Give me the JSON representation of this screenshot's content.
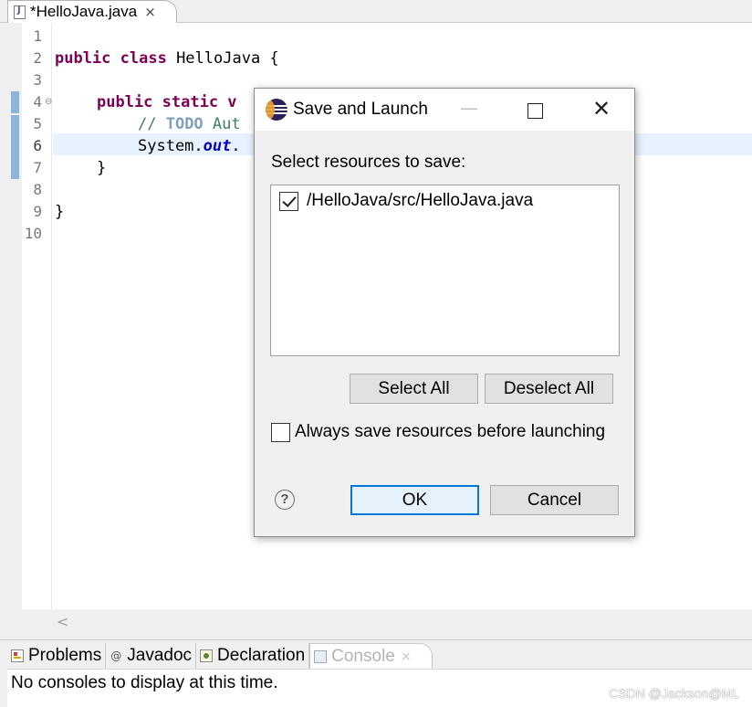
{
  "editor": {
    "tab_title": "*HelloJava.java",
    "tab_close": "×",
    "line_numbers": [
      "1",
      "2",
      "3",
      "4",
      "5",
      "6",
      "7",
      "8",
      "9",
      "10"
    ],
    "code": {
      "l2_kw": "public class",
      "l2_rest": " HelloJava {",
      "l4_kw": "public static",
      "l4_rest": " v",
      "l5_comment": "// ",
      "l5_todo": "TODO",
      "l5_rest": " Aut",
      "l6_pre": "System.",
      "l6_field": "out",
      "l6_post": ".",
      "l7": "}",
      "l9": "}"
    },
    "scroll_left_glyph": "<"
  },
  "bottom_views": {
    "tabs": [
      {
        "label": "Problems"
      },
      {
        "label": "Javadoc",
        "icon_glyph": "@"
      },
      {
        "label": "Declaration"
      },
      {
        "label": "Console",
        "close": "×"
      }
    ],
    "console_message": "No consoles to display at this time.",
    "watermark": "CSDN @Jackson@ML"
  },
  "dialog": {
    "title": "Save and Launch",
    "minimize_glyph": "—",
    "close_glyph": "✕",
    "select_label": "Select resources to save:",
    "resources": [
      {
        "path": "/HelloJava/src/HelloJava.java",
        "checked": true
      }
    ],
    "select_all": "Select All",
    "deselect_all": "Deselect All",
    "always_save": "Always save resources before launching",
    "always_save_checked": false,
    "help_glyph": "?",
    "ok": "OK",
    "cancel": "Cancel"
  }
}
